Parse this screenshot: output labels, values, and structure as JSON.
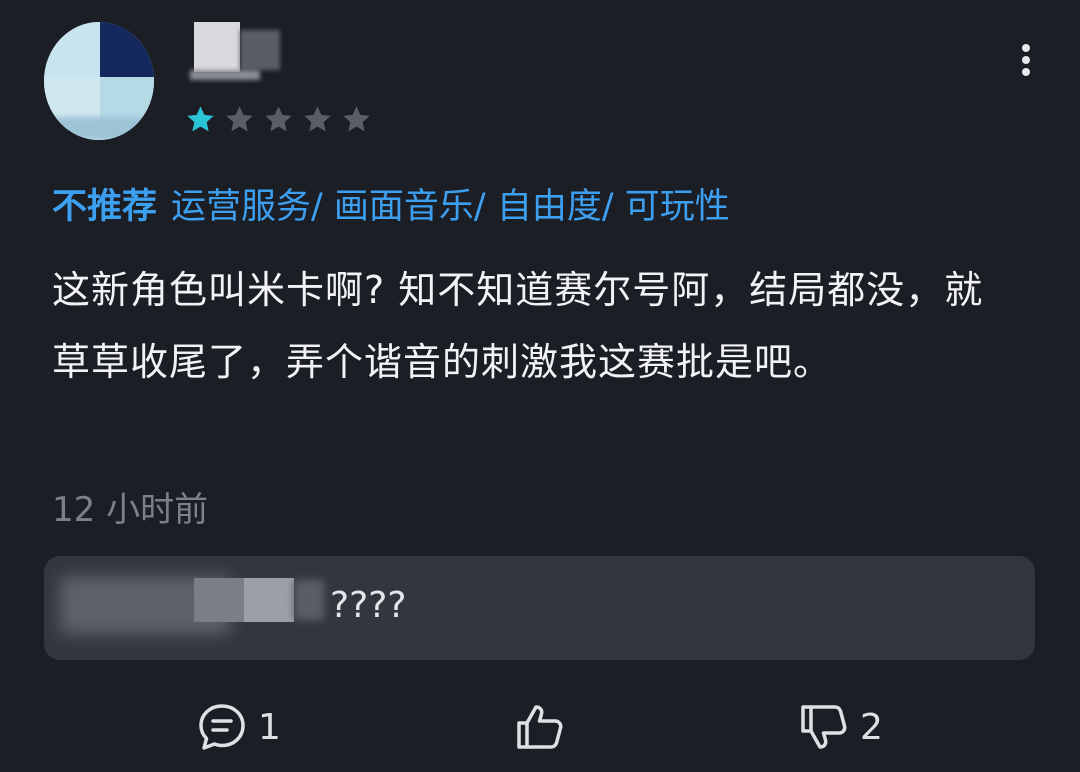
{
  "review": {
    "rating": {
      "value": 1,
      "max": 5,
      "filled_color": "#2bc4d6",
      "empty_color": "#5a5d66"
    },
    "verdict": "不推荐",
    "tags": "运营服务/ 画面音乐/ 自由度/ 可玩性",
    "content": "这新角色叫米卡啊? 知不知道赛尔号阿，结局都没，就草草收尾了，弄个谐音的刺激我这赛批是吧。",
    "time": "12 小时前"
  },
  "reply": {
    "text": "????"
  },
  "actions": {
    "comment": {
      "icon": "comment-icon",
      "count": "1"
    },
    "like": {
      "icon": "thumbs-up-icon",
      "count": ""
    },
    "dislike": {
      "icon": "thumbs-down-icon",
      "count": "2"
    }
  },
  "more": {
    "icon": "more-vertical-icon"
  },
  "colors": {
    "background": "#1c1e26",
    "accent": "#3c9ff0",
    "reply_bg": "#33363f",
    "muted": "#7d808a"
  }
}
